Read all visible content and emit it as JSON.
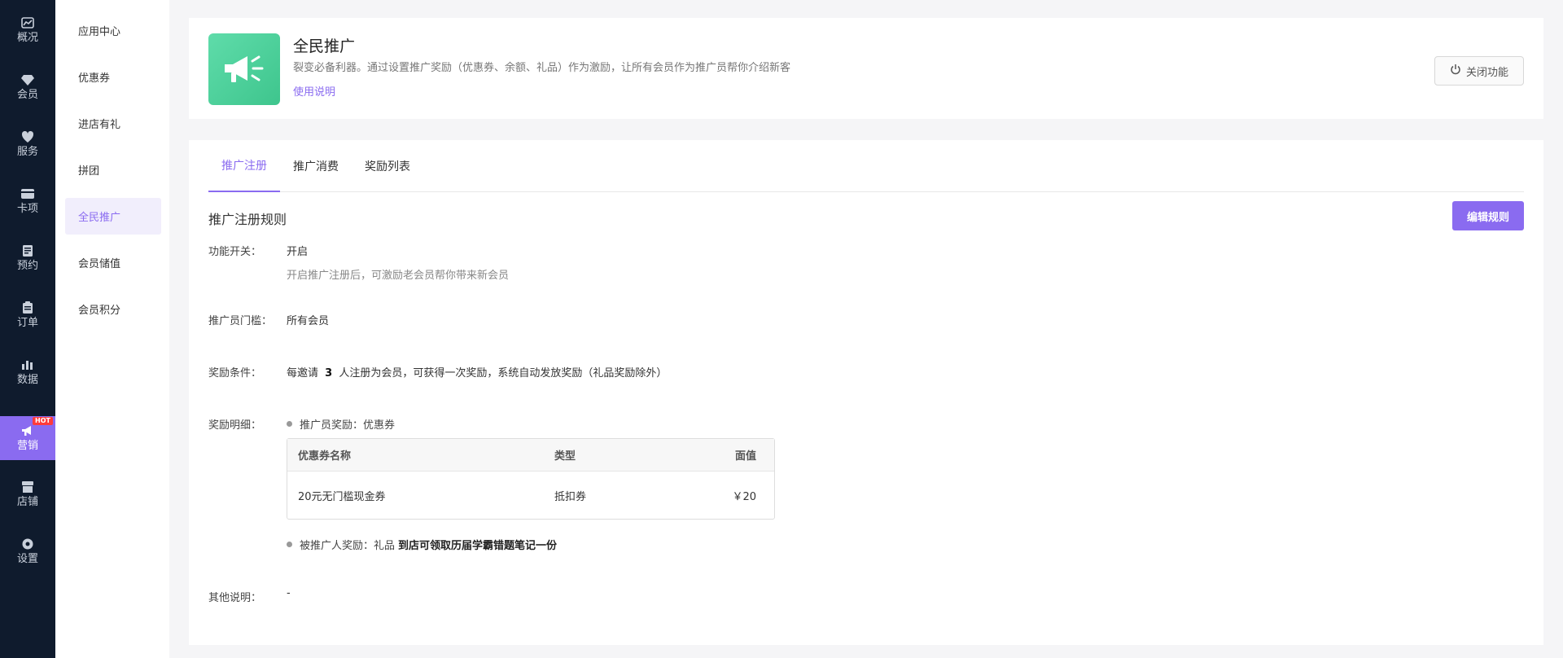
{
  "rail": {
    "items": [
      {
        "label": "概况",
        "icon": "overview-icon"
      },
      {
        "label": "会员",
        "icon": "diamond-icon"
      },
      {
        "label": "服务",
        "icon": "service-icon"
      },
      {
        "label": "卡项",
        "icon": "card-icon"
      },
      {
        "label": "预约",
        "icon": "appointment-icon"
      },
      {
        "label": "订单",
        "icon": "order-icon"
      },
      {
        "label": "数据",
        "icon": "chart-icon"
      },
      {
        "label": "营销",
        "icon": "megaphone-icon",
        "badge": "HOT"
      },
      {
        "label": "店铺",
        "icon": "store-icon"
      },
      {
        "label": "设置",
        "icon": "gear-icon"
      }
    ],
    "active": "营销"
  },
  "submenu": {
    "items": [
      "应用中心",
      "优惠券",
      "进店有礼",
      "拼团",
      "全民推广",
      "会员储值",
      "会员积分"
    ],
    "active": "全民推广"
  },
  "header": {
    "title": "全民推广",
    "description": "裂变必备利器。通过设置推广奖励（优惠券、余额、礼品）作为激励，让所有会员作为推广员帮你介绍新客",
    "help_link": "使用说明",
    "close_button": "关闭功能"
  },
  "tabs": [
    "推广注册",
    "推广消费",
    "奖励列表"
  ],
  "active_tab": "推广注册",
  "rules": {
    "title": "推广注册规则",
    "edit_button": "编辑规则",
    "switch_label": "功能开关：",
    "switch_value": "开启",
    "switch_hint": "开启推广注册后，可激励老会员帮你带来新会员",
    "threshold_label": "推广员门槛：",
    "threshold_value": "所有会员",
    "condition_label": "奖励条件：",
    "condition_prefix": "每邀请",
    "condition_count": "3",
    "condition_suffix": "人注册为会员，可获得一次奖励，系统自动发放奖励（礼品奖励除外）",
    "detail_label": "奖励明细：",
    "promoter_reward": "推广员奖励：优惠券",
    "table": {
      "headers": [
        "优惠券名称",
        "类型",
        "面值"
      ],
      "rows": [
        [
          "20元无门槛现金券",
          "抵扣券",
          "￥20"
        ]
      ]
    },
    "invitee_reward_prefix": "被推广人奖励：礼品",
    "invitee_reward_gift": "到店可领取历届学霸错题笔记一份",
    "other_label": "其他说明：",
    "other_value": "-"
  },
  "colors": {
    "accent": "#8a6bf0",
    "rail_bg": "#0f1b2d",
    "icon_green": "#4dd09a"
  }
}
